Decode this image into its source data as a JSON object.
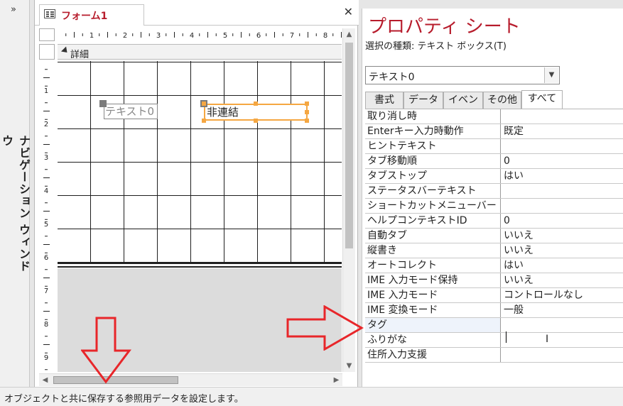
{
  "nav": {
    "toggle": "»",
    "label": "ナビゲーション ウィンドウ"
  },
  "form_tab": {
    "title": "フォーム1",
    "close": "✕"
  },
  "section": {
    "label": "詳細"
  },
  "controls": {
    "label_text": "テキスト0",
    "field_text": "非連結"
  },
  "h_ruler_numbers": [
    "1",
    "2",
    "3",
    "4",
    "5",
    "6",
    "7",
    "8"
  ],
  "v_ruler_numbers": [
    "1",
    "2",
    "3",
    "4",
    "5",
    "6",
    "7",
    "8",
    "9"
  ],
  "property_sheet": {
    "title": "プロパティ シート",
    "selection_kind": "選択の種類: テキスト ボックス(T)",
    "combo_value": "テキスト0",
    "tabs": [
      "書式",
      "データ",
      "イベント",
      "その他",
      "すべて"
    ],
    "active_tab": "すべて",
    "rows": [
      {
        "key": "取り消し時",
        "value": ""
      },
      {
        "key": "Enterキー入力時動作",
        "value": "既定"
      },
      {
        "key": "ヒントテキスト",
        "value": ""
      },
      {
        "key": "タブ移動順",
        "value": "0"
      },
      {
        "key": "タブストップ",
        "value": "はい"
      },
      {
        "key": "ステータスバーテキスト",
        "value": ""
      },
      {
        "key": "ショートカットメニューバー",
        "value": ""
      },
      {
        "key": "ヘルプコンテキストID",
        "value": "0"
      },
      {
        "key": "自動タブ",
        "value": "いいえ"
      },
      {
        "key": "縦書き",
        "value": "いいえ"
      },
      {
        "key": "オートコレクト",
        "value": "はい"
      },
      {
        "key": "IME 入力モード保持",
        "value": "いいえ"
      },
      {
        "key": "IME 入力モード",
        "value": "コントロールなし"
      },
      {
        "key": "IME 変換モード",
        "value": "一般"
      },
      {
        "key": "タグ",
        "value": ""
      },
      {
        "key": "ふりがな",
        "value": ""
      },
      {
        "key": "住所入力支援",
        "value": ""
      }
    ]
  },
  "status_bar": {
    "text": "オブジェクトと共に保存する参照用データを設定します。"
  },
  "colors": {
    "accent": "#b71c2c",
    "selection": "#f5a742",
    "arrow": "#e8262a"
  }
}
